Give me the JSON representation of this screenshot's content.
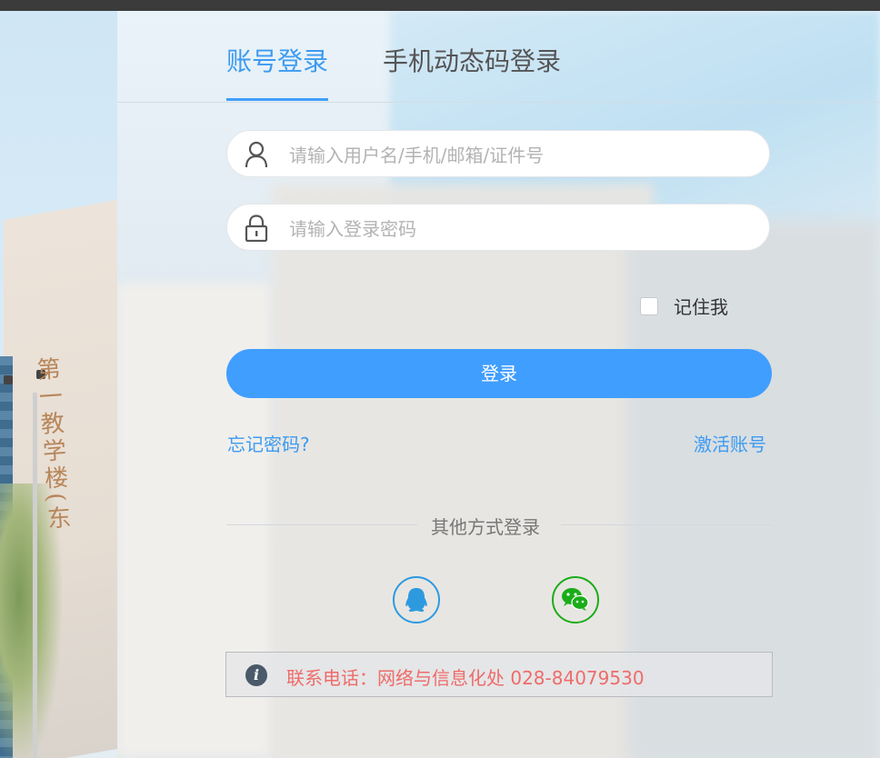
{
  "tabs": {
    "account_login": "账号登录",
    "sms_login": "手机动态码登录"
  },
  "login_form": {
    "username_placeholder": "请输入用户名/手机/邮箱/证件号",
    "username_value": "",
    "password_placeholder": "请输入登录密码",
    "password_value": "",
    "remember_label": "记住我",
    "remember_checked": false,
    "submit_label": "登录",
    "forgot_password": "忘记密码?",
    "activate_account": "激活账号"
  },
  "other_login": {
    "title": "其他方式登录",
    "methods": [
      {
        "icon": "qq-icon",
        "color": "#2d9ae0"
      },
      {
        "icon": "wechat-icon",
        "color": "#1aad19"
      }
    ]
  },
  "notice": {
    "icon": "info-icon",
    "text": "联系电话：网络与信息化处 028-84079530"
  },
  "background": {
    "building_sign": "第一教学楼(东"
  },
  "colors": {
    "accent": "#409eff",
    "notice_text": "#ef6b6b"
  }
}
